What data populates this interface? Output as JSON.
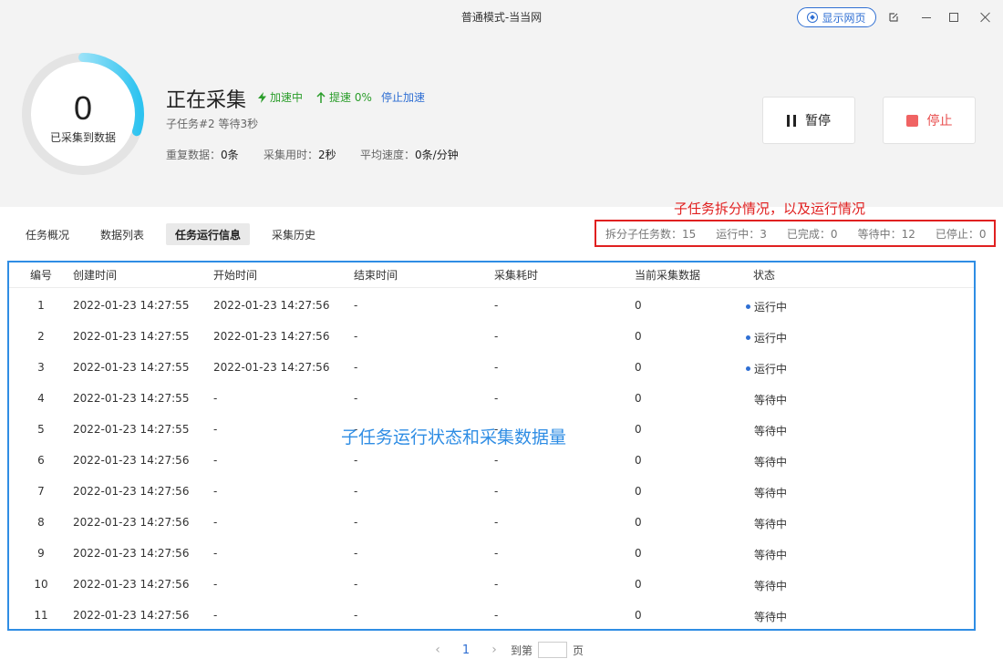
{
  "window": {
    "title": "普通模式-当当网",
    "show_web_label": "显示网页"
  },
  "header": {
    "collected_count": "0",
    "collected_label": "已采集到数据",
    "progress": 0.3,
    "status_title": "正在采集",
    "accel_label": "加速中",
    "speedup_label": "提速 0%",
    "stop_accel_label": "停止加速",
    "subtask_info": "子任务#2 等待3秒",
    "dup_label": "重复数据：",
    "dup_value": "0条",
    "time_label": "采集用时：",
    "time_value": "2秒",
    "speed_label": "平均速度：",
    "speed_value": "0条/分钟",
    "pause_label": "暂停",
    "stop_label": "停止"
  },
  "annotations": {
    "red": "子任务拆分情况，以及运行情况",
    "blue": "子任务运行状态和采集数据量"
  },
  "tabs": [
    {
      "label": "任务概况",
      "active": false
    },
    {
      "label": "数据列表",
      "active": false
    },
    {
      "label": "任务运行信息",
      "active": true
    },
    {
      "label": "采集历史",
      "active": false
    }
  ],
  "summary": {
    "split": "拆分子任务数：15",
    "running": "运行中：3",
    "done": "已完成：0",
    "waiting": "等待中：12",
    "stopped": "已停止：0"
  },
  "table": {
    "columns": [
      "编号",
      "创建时间",
      "开始时间",
      "结束时间",
      "采集耗时",
      "当前采集数据",
      "状态"
    ],
    "rows": [
      {
        "id": "1",
        "created": "2022-01-23 14:27:55",
        "start": "2022-01-23 14:27:56",
        "end": "-",
        "elapsed": "-",
        "count": "0",
        "status": "运行中"
      },
      {
        "id": "2",
        "created": "2022-01-23 14:27:55",
        "start": "2022-01-23 14:27:56",
        "end": "-",
        "elapsed": "-",
        "count": "0",
        "status": "运行中"
      },
      {
        "id": "3",
        "created": "2022-01-23 14:27:55",
        "start": "2022-01-23 14:27:56",
        "end": "-",
        "elapsed": "-",
        "count": "0",
        "status": "运行中"
      },
      {
        "id": "4",
        "created": "2022-01-23 14:27:55",
        "start": "-",
        "end": "-",
        "elapsed": "-",
        "count": "0",
        "status": "等待中"
      },
      {
        "id": "5",
        "created": "2022-01-23 14:27:55",
        "start": "-",
        "end": "-",
        "elapsed": "-",
        "count": "0",
        "status": "等待中"
      },
      {
        "id": "6",
        "created": "2022-01-23 14:27:56",
        "start": "-",
        "end": "-",
        "elapsed": "-",
        "count": "0",
        "status": "等待中"
      },
      {
        "id": "7",
        "created": "2022-01-23 14:27:56",
        "start": "-",
        "end": "-",
        "elapsed": "-",
        "count": "0",
        "status": "等待中"
      },
      {
        "id": "8",
        "created": "2022-01-23 14:27:56",
        "start": "-",
        "end": "-",
        "elapsed": "-",
        "count": "0",
        "status": "等待中"
      },
      {
        "id": "9",
        "created": "2022-01-23 14:27:56",
        "start": "-",
        "end": "-",
        "elapsed": "-",
        "count": "0",
        "status": "等待中"
      },
      {
        "id": "10",
        "created": "2022-01-23 14:27:56",
        "start": "-",
        "end": "-",
        "elapsed": "-",
        "count": "0",
        "status": "等待中"
      },
      {
        "id": "11",
        "created": "2022-01-23 14:27:56",
        "start": "-",
        "end": "-",
        "elapsed": "-",
        "count": "0",
        "status": "等待中"
      }
    ]
  },
  "pager": {
    "current": "1",
    "goto_label": "到第",
    "page_unit": "页"
  },
  "colors": {
    "accent": "#2f6fd3",
    "running_green": "#2a9d2a",
    "stop_red": "#f06363",
    "annotation_red": "#e02020",
    "annotation_blue": "#2f8de4",
    "ring_gradient_end": "#2ec3f0"
  }
}
